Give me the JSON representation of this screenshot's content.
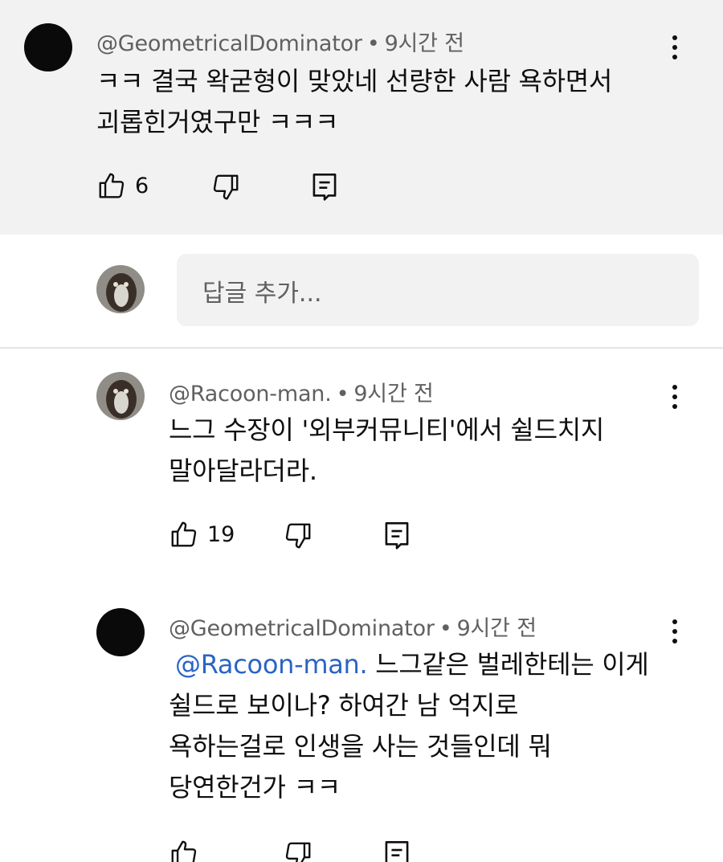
{
  "comment_main": {
    "author": "@GeometricalDominator",
    "time": "9시간 전",
    "lines": [
      "ㅋㅋ 결국 왁굳형이 맞았네 선량한 사람 욕하면서",
      "괴롭힌거였구만 ㅋㅋㅋ"
    ],
    "likes": "6"
  },
  "reply_input": {
    "placeholder": "답글 추가..."
  },
  "reply_1": {
    "author": "@Racoon-man.",
    "time": "9시간 전",
    "lines": [
      "느그 수장이 '외부커뮤니티'에서 쉴드치지",
      "말아달라더라."
    ],
    "likes": "19"
  },
  "reply_2": {
    "author": "@GeometricalDominator",
    "time": "9시간 전",
    "mention": "@Racoon-man.",
    "lines": [
      "느그같은 벌레한테는 이게",
      "쉴드로 보이나? 하여간 남 억지로",
      "욕하는걸로 인생을 사는 것들인데 뭐",
      "당연한건가 ㅋㅋ"
    ]
  },
  "separator": "•",
  "icons": [
    "like-icon",
    "dislike-icon",
    "reply-icon",
    "more-options-icon"
  ],
  "colors": {
    "highlight_bg": "#f2f2f2",
    "mention": "#2a64c5",
    "meta_text": "#606060"
  }
}
